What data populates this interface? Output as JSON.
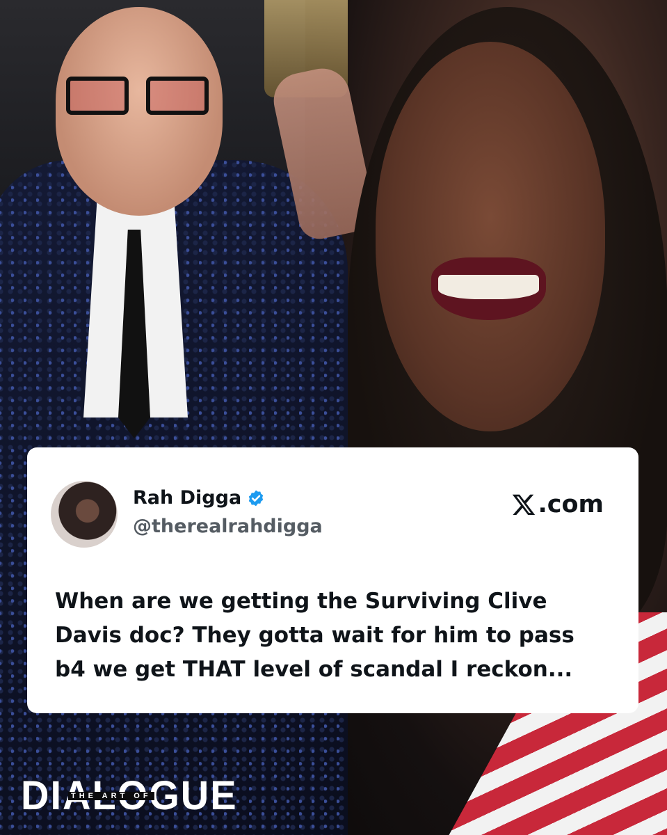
{
  "tweet": {
    "display_name": "Rah Digga",
    "handle": "@therealrahdigga",
    "verified": true,
    "source_label": ".com",
    "text": "When are we getting the Surviving Clive Davis doc? They gotta wait for him to pass b4 we get THAT level of scandal I reckon..."
  },
  "logo": {
    "main": "DIALOGUE",
    "sub": "THE ART OF"
  },
  "colors": {
    "verified_blue": "#1d9bf0",
    "card_bg": "#ffffff",
    "text_dark": "#0f1419",
    "handle_gray": "#555c63"
  }
}
